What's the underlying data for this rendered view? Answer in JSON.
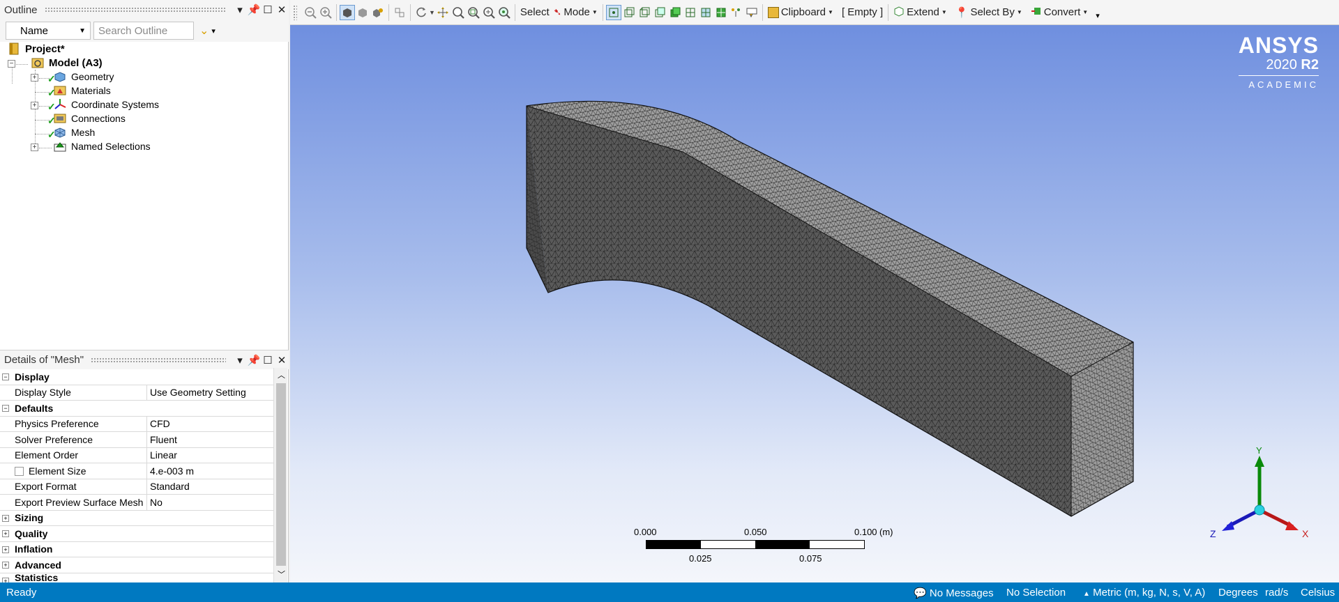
{
  "outline_panel": {
    "title": "Outline",
    "filter_select": "Name",
    "search_placeholder": "Search Outline",
    "tree": [
      {
        "label": "Project*",
        "icon": "project-icon"
      },
      {
        "label": "Model (A3)",
        "icon": "model-icon"
      },
      {
        "label": "Geometry",
        "icon": "geometry-icon"
      },
      {
        "label": "Materials",
        "icon": "materials-icon"
      },
      {
        "label": "Coordinate Systems",
        "icon": "coordinate-systems-icon"
      },
      {
        "label": "Connections",
        "icon": "connections-icon"
      },
      {
        "label": "Mesh",
        "icon": "mesh-icon"
      },
      {
        "label": "Named Selections",
        "icon": "named-selections-icon"
      }
    ]
  },
  "details_panel": {
    "title": "Details of \"Mesh\"",
    "groups": {
      "display": "Display",
      "defaults": "Defaults",
      "sizing": "Sizing",
      "quality": "Quality",
      "inflation": "Inflation",
      "advanced": "Advanced",
      "statistics": "Statistics"
    },
    "rows": [
      {
        "key": "Display Style",
        "value": "Use Geometry Setting"
      },
      {
        "key": "Physics Preference",
        "value": "CFD"
      },
      {
        "key": "Solver Preference",
        "value": "Fluent"
      },
      {
        "key": "Element Order",
        "value": "Linear"
      },
      {
        "key": "Element Size",
        "value": "4.e-003 m"
      },
      {
        "key": "Export Format",
        "value": "Standard"
      },
      {
        "key": "Export Preview Surface Mesh",
        "value": "No"
      }
    ]
  },
  "toolbar": {
    "select": "Select",
    "mode": "Mode",
    "clipboard": "Clipboard",
    "empty": "[ Empty ]",
    "extend": "Extend",
    "select_by": "Select By",
    "convert": "Convert"
  },
  "viewport": {
    "brand": "ANSYS",
    "version": "2020",
    "release": "R2",
    "edition": "ACADEMIC",
    "scale": {
      "top_labels": [
        "0.000",
        "0.050",
        "0.100"
      ],
      "unit": "(m)",
      "bottom_labels": [
        "0.025",
        "0.075"
      ]
    },
    "triad": {
      "x": "X",
      "y": "Y",
      "z": "Z"
    }
  },
  "status": {
    "ready": "Ready",
    "messages": "No Messages",
    "selection": "No Selection",
    "units": "Metric (m, kg, N, s, V, A)",
    "angle": "Degrees",
    "angular_velocity": "rad/s",
    "temperature": "Celsius"
  },
  "colors": {
    "status_bar": "#0079c1",
    "check": "#1b9e1b",
    "viewport_top": "#6f8fdf",
    "viewport_bottom": "#f4f6fb"
  }
}
